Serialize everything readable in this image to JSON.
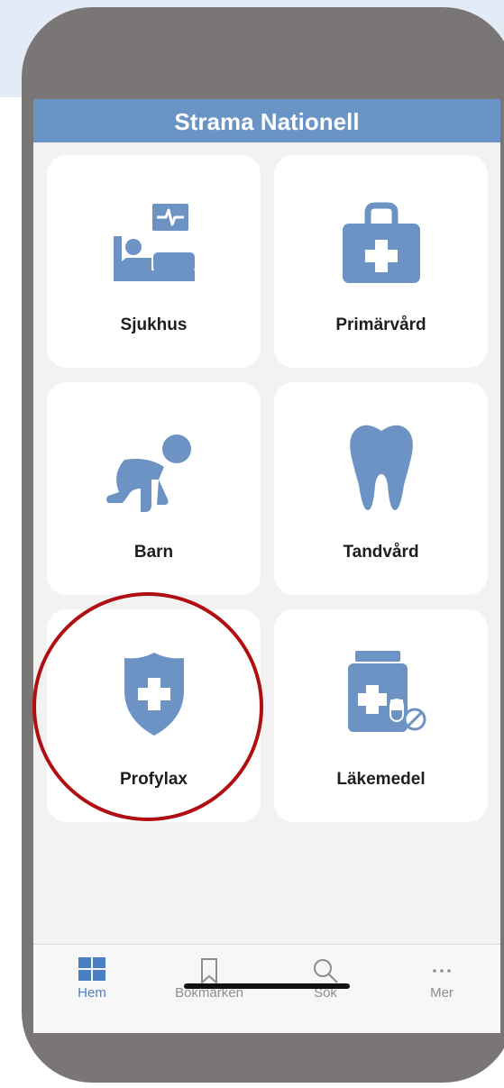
{
  "header": {
    "title": "Strama Nationell"
  },
  "tiles": [
    {
      "label": "Sjukhus",
      "icon": "hospital-bed-icon"
    },
    {
      "label": "Primärvård",
      "icon": "medical-bag-icon"
    },
    {
      "label": "Barn",
      "icon": "crawling-baby-icon"
    },
    {
      "label": "Tandvård",
      "icon": "tooth-icon"
    },
    {
      "label": "Profylax",
      "icon": "shield-cross-icon"
    },
    {
      "label": "Läkemedel",
      "icon": "medicine-bottle-icon"
    }
  ],
  "tabbar": {
    "items": [
      {
        "label": "Hem",
        "icon": "grid-icon",
        "active": true
      },
      {
        "label": "Bokmärken",
        "icon": "bookmark-icon",
        "active": false
      },
      {
        "label": "Sök",
        "icon": "search-icon",
        "active": false
      },
      {
        "label": "Mer",
        "icon": "more-icon",
        "active": false
      }
    ]
  },
  "colors": {
    "accent": "#6a93c6",
    "icon": "#6c93c4",
    "highlight_circle": "#b00f12",
    "active_tab": "#4a7fc1"
  }
}
